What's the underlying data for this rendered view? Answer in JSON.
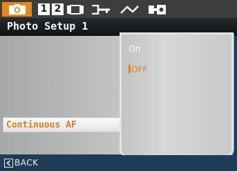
{
  "tabs": [
    {
      "id": "photo-setup",
      "icon": "camera-icon",
      "selected": true
    },
    {
      "id": "setup-1",
      "label": "1"
    },
    {
      "id": "setup-2",
      "label": "2"
    },
    {
      "id": "display",
      "icon": "display-icon"
    },
    {
      "id": "key",
      "icon": "key-icon"
    },
    {
      "id": "transfer",
      "icon": "transfer-icon"
    },
    {
      "id": "connection",
      "icon": "connection-icon"
    }
  ],
  "header": {
    "title": "Photo Setup 1"
  },
  "menu": {
    "selected_item": "Continuous AF"
  },
  "options": {
    "items": [
      "On",
      "OFF"
    ],
    "selected": "OFF"
  },
  "footer": {
    "back_label": "BACK"
  },
  "colors": {
    "accent": "#e1801a",
    "tab_bar": "#3c3d3d",
    "footer": "#1e3c55"
  }
}
